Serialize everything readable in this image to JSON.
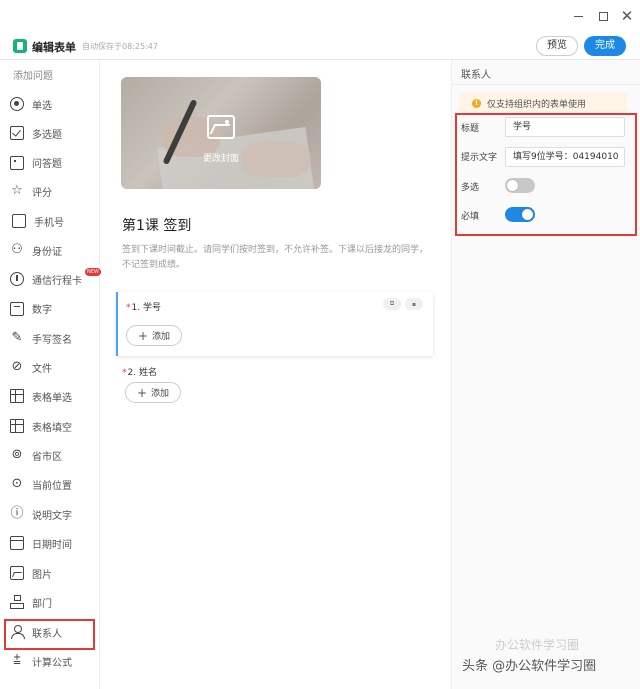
{
  "window": {
    "minimize_label": "minimize",
    "maximize_label": "maximize",
    "close_glyph": "✕"
  },
  "header": {
    "title": "编辑表单",
    "autosave": "自动保存于08:25:47",
    "preview_label": "预览",
    "done_label": "完成",
    "accent_color": "#1e88e5",
    "logo_color": "#15b374"
  },
  "sidebar": {
    "title": "添加问题",
    "items": [
      {
        "label": "单选",
        "icon": "radio-icon"
      },
      {
        "label": "多选题",
        "icon": "checkbox-icon"
      },
      {
        "label": "问答题",
        "icon": "textbox-icon"
      },
      {
        "label": "评分",
        "icon": "star-icon"
      },
      {
        "label": "手机号",
        "icon": "phone-icon"
      },
      {
        "label": "身份证",
        "icon": "id-card-icon"
      },
      {
        "label": "通信行程卡",
        "icon": "travel-card-icon",
        "badge": "NEW"
      },
      {
        "label": "数字",
        "icon": "number-icon"
      },
      {
        "label": "手写签名",
        "icon": "signature-icon"
      },
      {
        "label": "文件",
        "icon": "paperclip-icon"
      },
      {
        "label": "表格单选",
        "icon": "table-radio-icon"
      },
      {
        "label": "表格填空",
        "icon": "table-fill-icon"
      },
      {
        "label": "省市区",
        "icon": "region-icon"
      },
      {
        "label": "当前位置",
        "icon": "location-icon"
      },
      {
        "label": "说明文字",
        "icon": "info-icon"
      },
      {
        "label": "日期时间",
        "icon": "calendar-icon"
      },
      {
        "label": "图片",
        "icon": "image-icon"
      },
      {
        "label": "部门",
        "icon": "org-icon"
      },
      {
        "label": "联系人",
        "icon": "person-icon"
      },
      {
        "label": "计算公式",
        "icon": "formula-icon"
      }
    ]
  },
  "form": {
    "cover_label": "更改封面",
    "title": "第1课 签到",
    "description": "签到下课时间截止。请同学们按时签到，不允许补签。下课以后接龙的同学，不记签到成绩。",
    "questions": [
      {
        "number_title": "1. 学号",
        "required": "*",
        "add_label": "添加"
      },
      {
        "number_title": "2. 姓名",
        "required": "*",
        "add_label": "添加"
      }
    ]
  },
  "panel": {
    "title": "联系人",
    "warning": "仅支持组织内的表单使用",
    "fields": {
      "title_label": "标题",
      "title_value": "学号",
      "hint_label": "提示文字",
      "hint_value": "填写9位学号：04194010",
      "multi_label": "多选",
      "multi_on": false,
      "required_label": "必填",
      "required_on": true
    }
  },
  "watermark": "头条 @办公软件学习圈",
  "watermark_faded": "办公软件学习圈"
}
